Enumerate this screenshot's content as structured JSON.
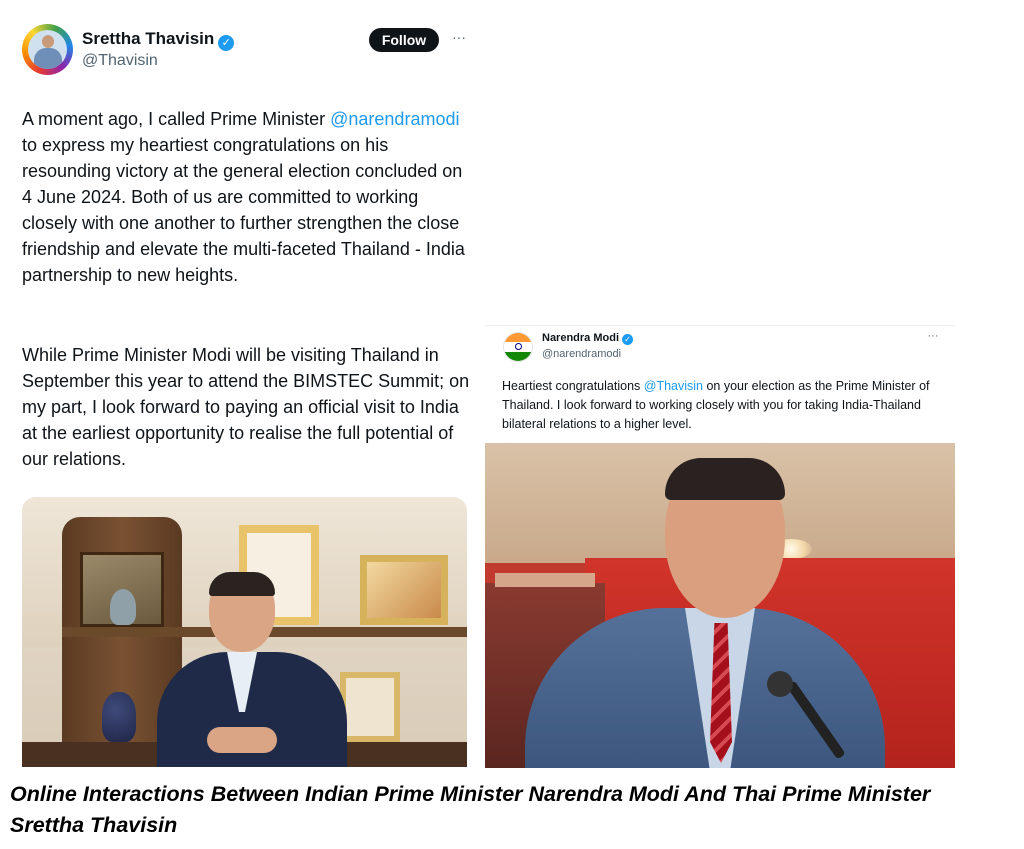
{
  "tweet1": {
    "author_name": "Srettha Thavisin",
    "verified_mark": "✓",
    "handle": "@Thavisin",
    "follow_label": "Follow",
    "more_label": "···",
    "text_part1": "A moment ago, I called Prime Minister ",
    "mention": "@narendramodi",
    "text_part2": " to express my heartiest congratulations on his resounding victory at the general election concluded on 4 June 2024. Both of us are committed to working closely with one another to further strengthen the close friendship and elevate the multi-faceted Thailand - India partnership to new heights.",
    "paragraph2": "While Prime Minister Modi will be visiting Thailand in September this year to attend the BIMSTEC Summit; on my part, I look forward to paying an official visit to India at the earliest opportunity to realise the full potential of our relations.",
    "avatar_icon": "profile-photo-rainbow-ring",
    "photo_icon": "office-portrait-photo"
  },
  "tweet2": {
    "author_name": "Narendra Modi",
    "verified_mark": "✓",
    "handle": "@narendramodi",
    "more_label": "···",
    "text_part1": "Heartiest congratulations ",
    "mention": "@Thavisin",
    "text_part2": " on your election as the Prime Minister of Thailand. I look forward to working closely with you for taking India-Thailand bilateral relations to a higher level.",
    "avatar_icon": "indian-flag-avatar",
    "photo_icon": "speaker-at-podium-photo"
  },
  "caption": "Online Interactions Between Indian Prime Minister Narendra Modi And Thai Prime Minister Srettha Thavisin",
  "colors": {
    "accent_blue": "#1d9bf0",
    "text_dark": "#0f1419",
    "text_muted": "#536471"
  }
}
